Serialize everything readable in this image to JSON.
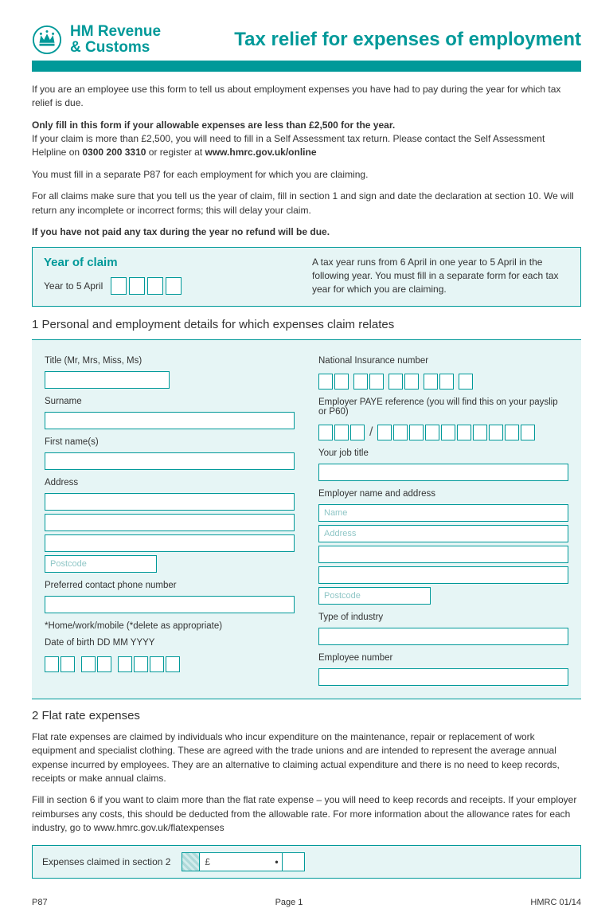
{
  "header": {
    "org_line1": "HM Revenue",
    "org_line2": "& Customs",
    "title": "Tax relief for expenses of employment"
  },
  "intro": {
    "p1": "If you are an employee use this form to tell us about employment expenses you have had to pay during the year for which tax relief is due.",
    "p2_bold": "Only fill in this form if your allowable expenses are less than £2,500 for the year.",
    "p2_rest_a": "If your claim is more than £2,500, you will need to fill in a Self Assessment tax return. Please contact the Self Assessment Helpline on ",
    "p2_phone": "0300 200 3310",
    "p2_rest_b": " or register at ",
    "p2_link": "www.hmrc.gov.uk/online",
    "p3": "You must fill in a separate P87 for each employment for which you are claiming.",
    "p4": "For all claims make sure that you tell us the year of claim, fill in section 1 and sign and date the declaration at section 10. We will return any incomplete or incorrect forms; this will delay your claim.",
    "p5_bold": "If you have not paid any tax during the year no refund will be due."
  },
  "year_box": {
    "heading": "Year of claim",
    "left_label": "Year to 5 April",
    "right_text": "A tax year runs from 6 April in one year to 5 April in the following year. You must fill in a separate form for each tax year for which you are claiming."
  },
  "section1": {
    "heading": "1 Personal and employment details for which expenses claim relates",
    "left": {
      "title": "Title (Mr, Mrs, Miss, Ms)",
      "surname": "Surname",
      "firstnames": "First name(s)",
      "address": "Address",
      "postcode_ph": "Postcode",
      "phone": "Preferred contact phone number",
      "phone_note": "*Home/work/mobile (*delete as appropriate)",
      "dob": "Date of birth  DD MM YYYY"
    },
    "right": {
      "nino": "National Insurance number",
      "paye": "Employer PAYE reference (you will find this on your payslip or P60)",
      "jobtitle": "Your job title",
      "employer": "Employer name and address",
      "name_ph": "Name",
      "address_ph": "Address",
      "postcode_ph": "Postcode",
      "industry": "Type of industry",
      "empno": "Employee number"
    }
  },
  "section2": {
    "heading": "2  Flat rate expenses",
    "p1_a": "Flat rate expenses are claimed by individuals who incur expenditure on the maintenance, repair or replacement of ",
    "p1_bold": "work equipment and specialist clothing",
    "p1_b": ". These are agreed with the trade unions and are intended to represent the average annual expense incurred by employees. They are an alternative to claiming actual expenditure and there is no need to keep records, receipts or make annual claims.",
    "p2_a": "Fill in section 6 if you want to claim more than the flat rate expense – you will need to keep records and receipts. If your employer reimburses any costs, this should be deducted from the allowable rate. For more information about the allowance rates for each industry, go to ",
    "p2_link": "www.hmrc.gov.uk/flatexpenses",
    "bar_label": "Expenses claimed in section 2",
    "currency": "£"
  },
  "footer": {
    "left": "P87",
    "center": "Page 1",
    "right": "HMRC 01/14"
  }
}
